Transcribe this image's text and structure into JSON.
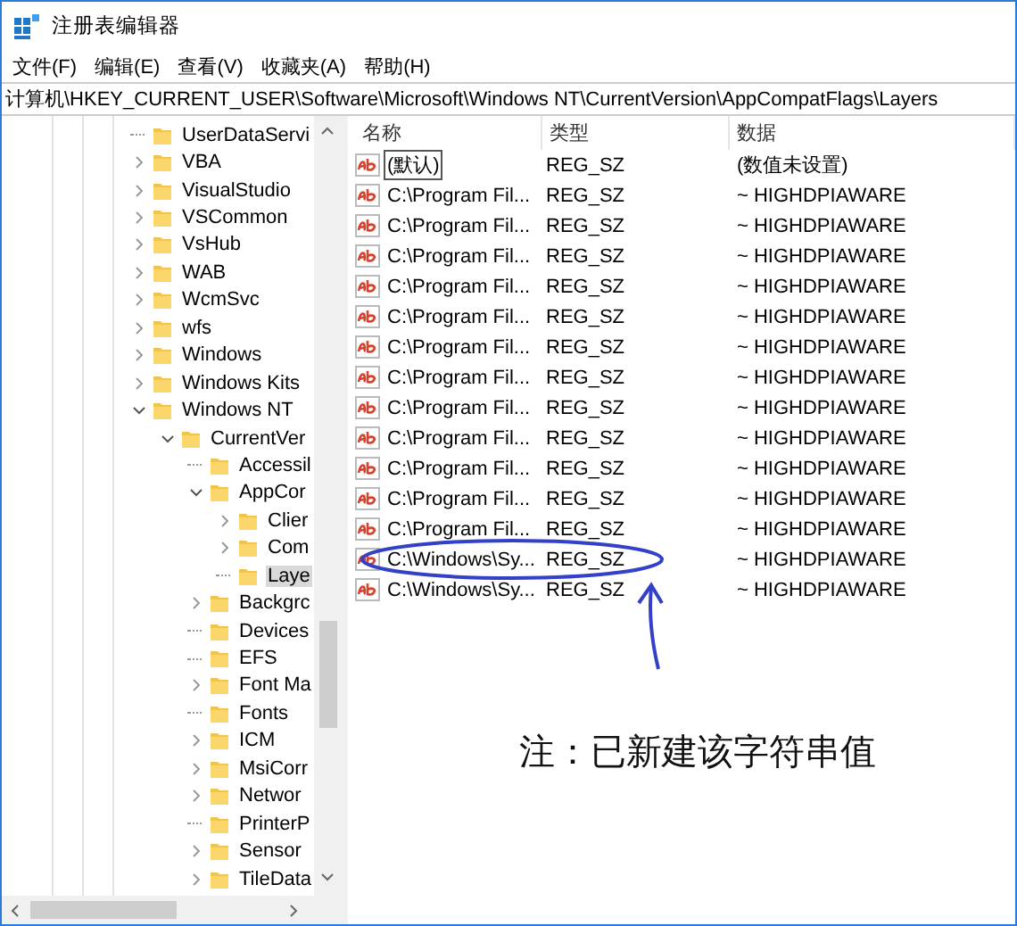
{
  "window": {
    "title": "注册表编辑器"
  },
  "menu": [
    "文件(F)",
    "编辑(E)",
    "查看(V)",
    "收藏夹(A)",
    "帮助(H)"
  ],
  "address": "计算机\\HKEY_CURRENT_USER\\Software\\Microsoft\\Windows NT\\CurrentVersion\\AppCompatFlags\\Layers",
  "tree": [
    {
      "label": "UserDataServi",
      "kind": "leaf",
      "selected": false
    },
    {
      "label": "VBA",
      "kind": "branch",
      "expanded": false,
      "selected": false
    },
    {
      "label": "VisualStudio",
      "kind": "branch",
      "expanded": false,
      "selected": false
    },
    {
      "label": "VSCommon",
      "kind": "branch",
      "expanded": false,
      "selected": false
    },
    {
      "label": "VsHub",
      "kind": "branch",
      "expanded": false,
      "selected": false
    },
    {
      "label": "WAB",
      "kind": "branch",
      "expanded": false,
      "selected": false
    },
    {
      "label": "WcmSvc",
      "kind": "branch",
      "expanded": false,
      "selected": false
    },
    {
      "label": "wfs",
      "kind": "branch",
      "expanded": false,
      "selected": false
    },
    {
      "label": "Windows",
      "kind": "branch",
      "expanded": false,
      "selected": false
    },
    {
      "label": "Windows Kits",
      "kind": "branch",
      "expanded": false,
      "selected": false
    },
    {
      "label": "Windows NT",
      "kind": "branch",
      "expanded": true,
      "selected": false,
      "children": [
        {
          "label": "CurrentVer",
          "kind": "branch",
          "expanded": true,
          "selected": false,
          "children": [
            {
              "label": "Accessil",
              "kind": "leaf",
              "selected": false
            },
            {
              "label": "AppCor",
              "kind": "branch",
              "expanded": true,
              "selected": false,
              "children": [
                {
                  "label": "Clier",
                  "kind": "branch",
                  "expanded": false,
                  "selected": false
                },
                {
                  "label": "Com",
                  "kind": "branch",
                  "expanded": false,
                  "selected": false
                },
                {
                  "label": "Laye",
                  "kind": "leaf",
                  "selected": true
                }
              ]
            },
            {
              "label": "Backgrc",
              "kind": "branch",
              "expanded": false,
              "selected": false
            },
            {
              "label": "Devices",
              "kind": "leaf",
              "selected": false
            },
            {
              "label": "EFS",
              "kind": "leaf",
              "selected": false
            },
            {
              "label": "Font Ma",
              "kind": "branch",
              "expanded": false,
              "selected": false
            },
            {
              "label": "Fonts",
              "kind": "leaf",
              "selected": false
            },
            {
              "label": "ICM",
              "kind": "branch",
              "expanded": false,
              "selected": false
            },
            {
              "label": "MsiCorr",
              "kind": "branch",
              "expanded": false,
              "selected": false
            },
            {
              "label": "Networ",
              "kind": "branch",
              "expanded": false,
              "selected": false
            },
            {
              "label": "PrinterP",
              "kind": "leaf",
              "selected": false
            },
            {
              "label": "Sensor",
              "kind": "branch",
              "expanded": false,
              "selected": false
            },
            {
              "label": "TileData",
              "kind": "branch",
              "expanded": false,
              "selected": false
            }
          ]
        }
      ]
    }
  ],
  "table": {
    "columns": [
      "名称",
      "类型",
      "数据"
    ],
    "rows": [
      {
        "name": "(默认)",
        "type": "REG_SZ",
        "data": "(数值未设置)",
        "focused": true
      },
      {
        "name": "C:\\Program Fil...",
        "type": "REG_SZ",
        "data": "~ HIGHDPIAWARE",
        "focused": false
      },
      {
        "name": "C:\\Program Fil...",
        "type": "REG_SZ",
        "data": "~ HIGHDPIAWARE",
        "focused": false
      },
      {
        "name": "C:\\Program Fil...",
        "type": "REG_SZ",
        "data": "~ HIGHDPIAWARE",
        "focused": false
      },
      {
        "name": "C:\\Program Fil...",
        "type": "REG_SZ",
        "data": "~ HIGHDPIAWARE",
        "focused": false
      },
      {
        "name": "C:\\Program Fil...",
        "type": "REG_SZ",
        "data": "~ HIGHDPIAWARE",
        "focused": false
      },
      {
        "name": "C:\\Program Fil...",
        "type": "REG_SZ",
        "data": "~ HIGHDPIAWARE",
        "focused": false
      },
      {
        "name": "C:\\Program Fil...",
        "type": "REG_SZ",
        "data": "~ HIGHDPIAWARE",
        "focused": false
      },
      {
        "name": "C:\\Program Fil...",
        "type": "REG_SZ",
        "data": "~ HIGHDPIAWARE",
        "focused": false
      },
      {
        "name": "C:\\Program Fil...",
        "type": "REG_SZ",
        "data": "~ HIGHDPIAWARE",
        "focused": false
      },
      {
        "name": "C:\\Program Fil...",
        "type": "REG_SZ",
        "data": "~ HIGHDPIAWARE",
        "focused": false
      },
      {
        "name": "C:\\Program Fil...",
        "type": "REG_SZ",
        "data": "~ HIGHDPIAWARE",
        "focused": false
      },
      {
        "name": "C:\\Program Fil...",
        "type": "REG_SZ",
        "data": "~ HIGHDPIAWARE",
        "focused": false
      },
      {
        "name": "C:\\Windows\\Sy...",
        "type": "REG_SZ",
        "data": "~ HIGHDPIAWARE",
        "focused": false,
        "circled": true
      },
      {
        "name": "C:\\Windows\\Sy...",
        "type": "REG_SZ",
        "data": "~ HIGHDPIAWARE",
        "focused": false
      }
    ]
  },
  "annotation": {
    "text": "注：已新建该字符串值"
  }
}
